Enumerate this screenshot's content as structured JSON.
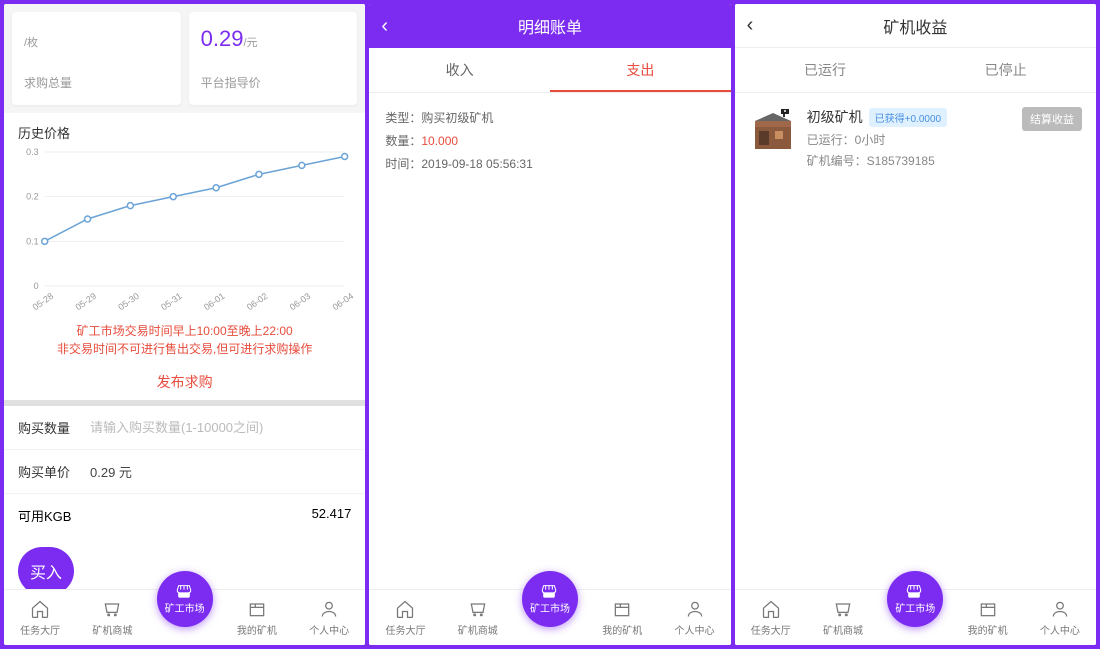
{
  "screen1": {
    "card1": {
      "value": "",
      "unit": "/枚",
      "label": "求购总量"
    },
    "card2": {
      "value": "0.29",
      "unit": "/元",
      "label": "平台指导价"
    },
    "history_title": "历史价格",
    "notice_line1": "矿工市场交易时间早上10:00至晚上22:00",
    "notice_line2": "非交易时间不可进行售出交易,但可进行求购操作",
    "publish_label": "发布求购",
    "qty_label": "购买数量",
    "qty_placeholder": "请输入购买数量(1-10000之间)",
    "price_label": "购买单价",
    "price_value": "0.29 元",
    "kgb_label": "可用KGB",
    "kgb_value": "52.417",
    "buy_label": "买入"
  },
  "screen2": {
    "title": "明细账单",
    "tab_income": "收入",
    "tab_expense": "支出",
    "type_label": "类型：",
    "type_value": "购买初级矿机",
    "qty_label": "数量：",
    "qty_value": "10.000",
    "time_label": "时间：",
    "time_value": "2019-09-18 05:56:31"
  },
  "screen3": {
    "title": "矿机收益",
    "tab_running": "已运行",
    "tab_stopped": "已停止",
    "miner_name": "初级矿机",
    "badge": "已获得+0.0000",
    "runtime_label": "已运行：",
    "runtime_value": "0小时",
    "serial_label": "矿机编号：",
    "serial_value": "S185739185",
    "settle": "结算收益"
  },
  "footer": {
    "tab1": "任务大厅",
    "tab2": "矿机商城",
    "tab3": "矿工市场",
    "tab4": "我的矿机",
    "tab5": "个人中心"
  },
  "chart_data": {
    "type": "line",
    "categories": [
      "05-28",
      "05-29",
      "05-30",
      "05-31",
      "06-01",
      "06-02",
      "06-03",
      "06-04"
    ],
    "values": [
      0.1,
      0.15,
      0.18,
      0.2,
      0.22,
      0.25,
      0.27,
      0.29
    ],
    "yticks": [
      0,
      0.1,
      0.2,
      0.3
    ],
    "ylim": [
      0,
      0.3
    ],
    "title": "历史价格",
    "xlabel": "",
    "ylabel": ""
  }
}
